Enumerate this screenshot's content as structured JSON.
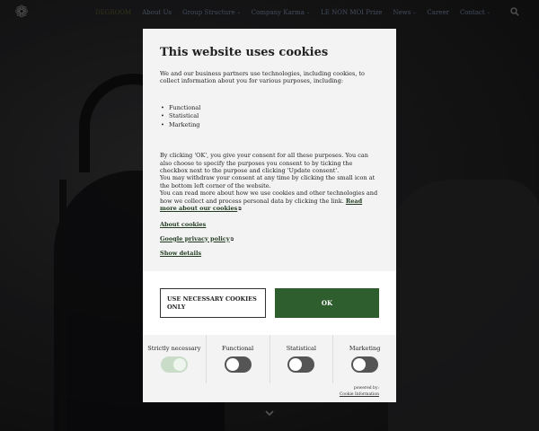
{
  "nav": {
    "items": [
      {
        "label": "DEGROOM",
        "chevron": false
      },
      {
        "label": "About Us",
        "chevron": false
      },
      {
        "label": "Group Structure",
        "chevron": true
      },
      {
        "label": "Company Karma",
        "chevron": true
      },
      {
        "label": "LE NON MOI Prize",
        "chevron": false
      },
      {
        "label": "News",
        "chevron": true
      },
      {
        "label": "Career",
        "chevron": false
      },
      {
        "label": "Contact",
        "chevron": true
      }
    ],
    "chevron_glyph": "⌄",
    "search_icon": "search-icon",
    "logo_glyph": "❁"
  },
  "dialog": {
    "title": "This website uses cookies",
    "intro": "We and our business partners use technologies, including cookies, to collect information about you for various purposes, including:",
    "purposes": [
      "Functional",
      "Statistical",
      "Marketing"
    ],
    "consent_text": "By clicking 'OK', you give your consent for all these purposes. You can also choose to specify the purposes you consent to by ticking the checkbox next to the purpose and clicking 'Update consent'.",
    "withdraw_text": "You may withdraw your consent at any time by clicking the small icon at the bottom left corner of the website.",
    "more_text": "You can read more about how we use cookies and other technologies and how we collect and process personal data by clicking the link.",
    "read_more_link": "Read more about our cookies",
    "about_cookies_link": "About cookies",
    "google_link": "Google privacy policy",
    "show_details_link": "Show details",
    "external_icon": "⧉",
    "btn_necessary": "USE NECESSARY COOKIES ONLY",
    "btn_ok": "OK",
    "toggles": [
      {
        "label": "Strictly necessary",
        "state": "on-locked"
      },
      {
        "label": "Functional",
        "state": "off"
      },
      {
        "label": "Statistical",
        "state": "off"
      },
      {
        "label": "Marketing",
        "state": "off"
      }
    ],
    "powered_by": "powered by:",
    "powered_link": "Cookie Information"
  },
  "colors": {
    "ok_button": "#2e5d2e",
    "link": "#1f3a1f",
    "nav_text": "#7a8aa8"
  }
}
